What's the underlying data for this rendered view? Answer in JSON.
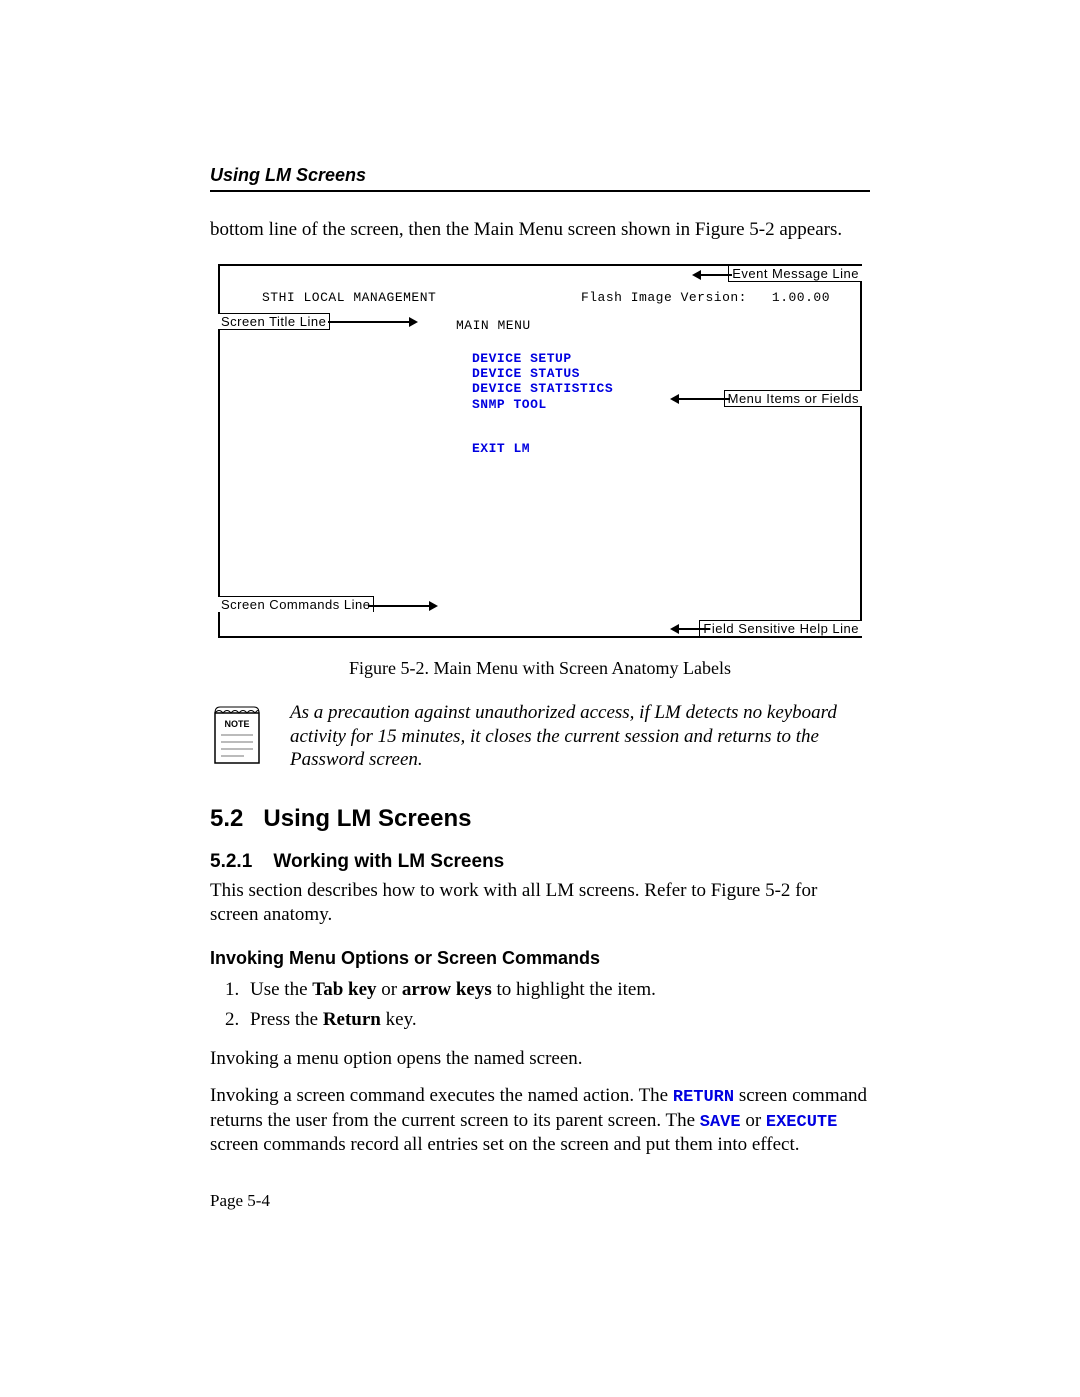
{
  "header": {
    "title": "Using LM Screens"
  },
  "intro": "bottom line of the screen, then the Main Menu screen shown in Figure 5-2 appears.",
  "figure": {
    "header_left": "STHI LOCAL MANAGEMENT",
    "header_right_prefix": "Flash Image Version:",
    "header_right_version": "1.00.00",
    "main_menu_title": "MAIN MENU",
    "menu_items": [
      "DEVICE SETUP",
      "DEVICE STATUS",
      "DEVICE STATISTICS",
      "SNMP TOOL"
    ],
    "exit_item": "EXIT LM",
    "callouts": {
      "event_msg": "Event Message Line",
      "title_line": "Screen Title Line",
      "menu_items": "Menu Items or Fields",
      "cmds_line": "Screen Commands Line",
      "help_line": "Field Sensitive Help Line"
    },
    "caption": "Figure 5-2.  Main Menu with Screen Anatomy Labels"
  },
  "note": {
    "badge": "NOTE",
    "text": "As a precaution against unauthorized access, if LM detects no keyboard activity for 15 minutes, it closes the current session and returns to the Password screen."
  },
  "sec": {
    "num": "5.2",
    "title": "Using LM Screens",
    "sub_num": "5.2.1",
    "sub_title": "Working with LM Screens",
    "sub_intro": "This section describes how to work with all LM screens. Refer to Figure 5-2 for screen anatomy.",
    "invoke_heading": "Invoking Menu Options or Screen Commands",
    "steps": {
      "s1_prefix": "Use the ",
      "s1_key1": "Tab key",
      "s1_mid": " or ",
      "s1_key2": "arrow keys",
      "s1_suffix": " to highlight the item.",
      "s2_prefix": "Press the ",
      "s2_key": "Return",
      "s2_suffix": " key."
    },
    "para_a": "Invoking a menu option opens the named screen.",
    "para_b": {
      "p1": "Invoking a screen command executes the named action. The ",
      "cmd1": "RETURN",
      "p2": " screen command returns the user from the current screen to its parent screen. The ",
      "cmd2": "SAVE",
      "p3": " or ",
      "cmd3": "EXECUTE",
      "p4": " screen commands record all entries set on the screen and put them into effect."
    }
  },
  "footer": {
    "page": "Page 5-4"
  }
}
